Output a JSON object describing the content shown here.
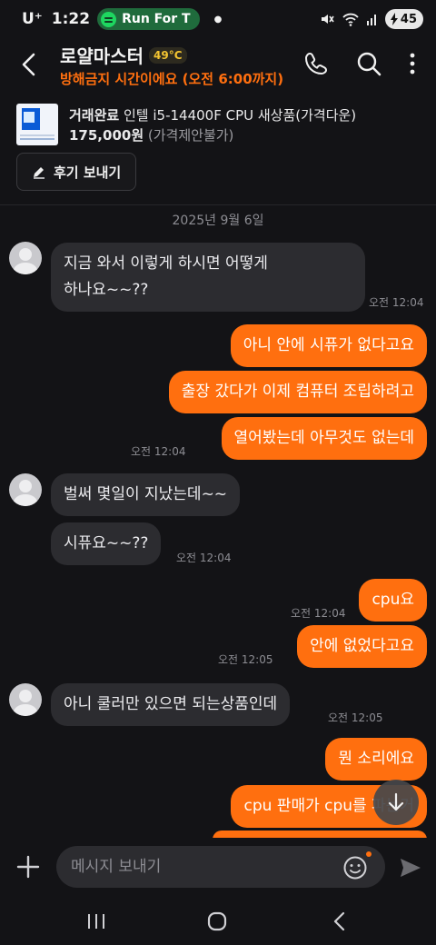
{
  "status_bar": {
    "carrier": "U⁺",
    "time": "1:22",
    "media_pill": "Run For T",
    "battery": "45"
  },
  "header": {
    "title": "로얄마스터",
    "temperature": "49°C",
    "notice": "방해금지 시간이에요 (오전 6:00까지)",
    "icons": [
      "back-icon",
      "phone-icon",
      "search-icon",
      "more-icon"
    ]
  },
  "product": {
    "status": "거래완료",
    "name": "인텔 i5-14400F CPU 새상품(가격다운)",
    "price": "175,000원",
    "price_note": "(가격제안불가)",
    "review_button": "후기 보내기"
  },
  "chat": {
    "date": "2025년 9월 6일",
    "messages": [
      {
        "side": "in",
        "text": "지금 와서 이렇게 하시면 어떻게"
      },
      {
        "side": "in",
        "text": "하나요~~??"
      },
      {
        "side": "in",
        "time": "오전 12:04"
      },
      {
        "side": "out",
        "text": "아니 안에 시퓨가 없다고요"
      },
      {
        "side": "out",
        "text": "출장 갔다가 이제 컴퓨터 조립하려고"
      },
      {
        "side": "out",
        "text": "열어봤는데 아무것도 없는데",
        "time": "오전 12:04"
      },
      {
        "side": "in",
        "text": "벌써 몇일이 지났는데~~"
      },
      {
        "side": "in",
        "text": "시퓨요~~??",
        "time": "오전 12:04"
      },
      {
        "side": "out",
        "text": "cpu요",
        "time": "오전 12:04"
      },
      {
        "side": "out",
        "text": "안에 없었다고요",
        "time": "오전 12:05"
      },
      {
        "side": "in",
        "text": "아니 쿨러만 있으면 되는상품인데",
        "time": "오전 12:05"
      },
      {
        "side": "out",
        "text": "뭔 소리에요"
      },
      {
        "side": "out",
        "text": "cpu 판매가 cpu를 파는거"
      }
    ]
  },
  "composer": {
    "placeholder": "메시지 보내기"
  },
  "colors": {
    "accent": "#ff6f0f",
    "background": "#131316",
    "incoming_bubble": "#2c2c30",
    "temperature": "#f3c431"
  }
}
